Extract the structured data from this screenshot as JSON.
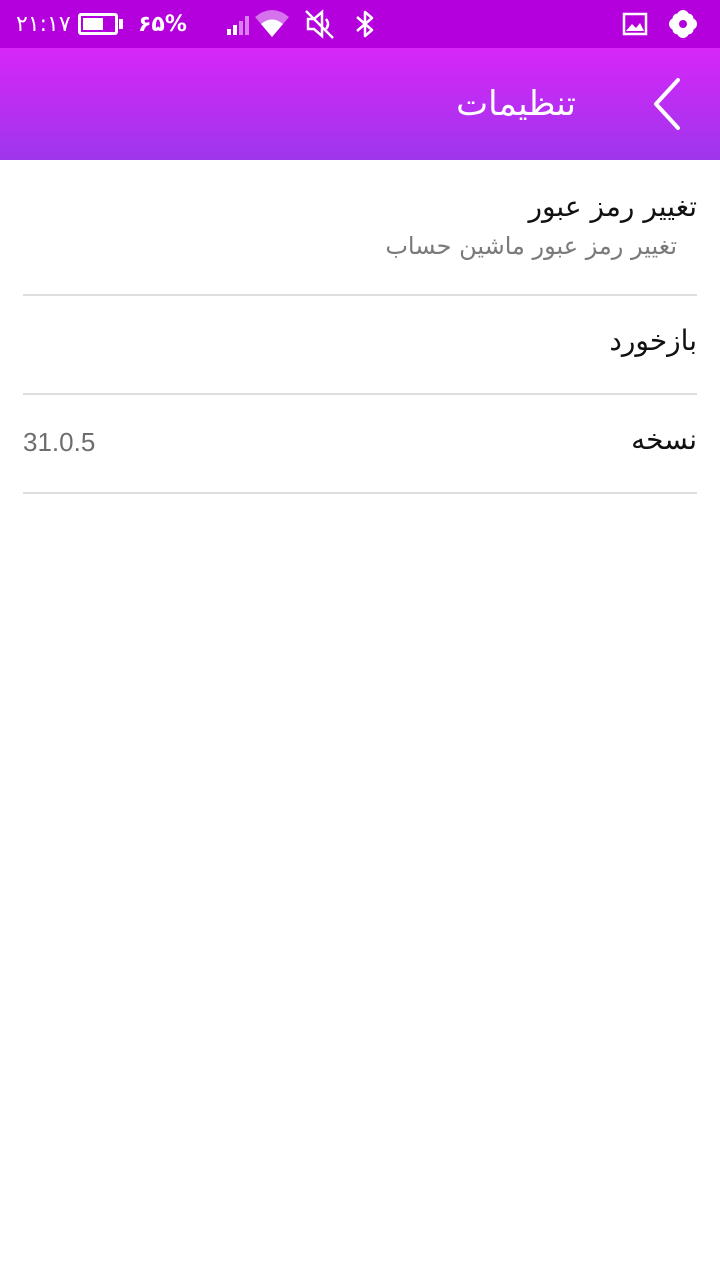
{
  "status_bar": {
    "time": "۲۱:۱۷",
    "battery_percent": "۶۵%",
    "battery_level": 0.65,
    "icons": [
      "battery-icon",
      "signal-icon",
      "wifi-icon",
      "mute-icon",
      "bluetooth-icon",
      "gallery-icon",
      "flower-icon"
    ]
  },
  "toolbar": {
    "title": "تنظیمات",
    "back_icon": "chevron-left-icon"
  },
  "settings": {
    "change_password": {
      "title": "تغییر رمز عبور",
      "subtitle": "تغییر رمز عبور ماشین حساب"
    },
    "feedback": {
      "title": "بازخورد"
    },
    "version": {
      "title": "نسخه",
      "value": "31.0.5"
    }
  },
  "colors": {
    "status_bar": "#b300dc",
    "toolbar_top": "#d726f8",
    "toolbar_bottom": "#9e36ec",
    "divider": "#dedede"
  }
}
